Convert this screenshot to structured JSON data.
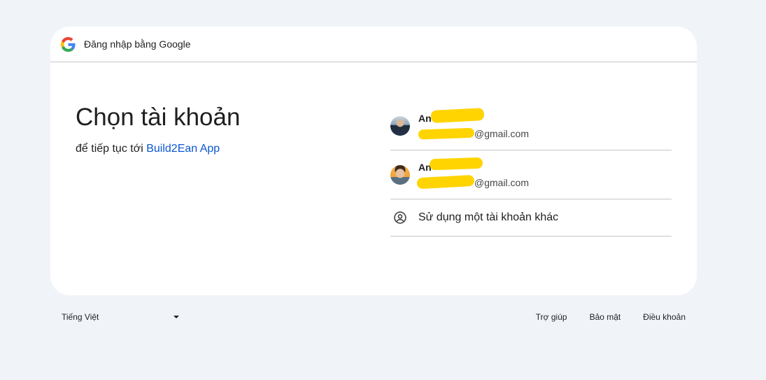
{
  "header": {
    "title": "Đăng nhập bằng Google"
  },
  "main": {
    "title": "Chọn tài khoản",
    "subtitle_prefix": "để tiếp tục tới",
    "app_name": "Build2Ean App"
  },
  "accounts": [
    {
      "name": "An",
      "email_suffix": "@gmail.com",
      "avatar": "avatar-photo-icon"
    },
    {
      "name": "An",
      "email_suffix": "@gmail.com",
      "avatar": "avatar-photo-icon"
    }
  ],
  "other_account": {
    "label": "Sử dụng một tài khoản khác",
    "icon": "account-circle-icon"
  },
  "footer": {
    "language": "Tiếng Việt",
    "links": [
      "Trợ giúp",
      "Bảo mật",
      "Điều khoản"
    ]
  },
  "colors": {
    "background": "#f0f4f9",
    "card": "#ffffff",
    "link": "#0b57d0",
    "divider": "#c7c7c7",
    "redaction": "#ffd400"
  }
}
